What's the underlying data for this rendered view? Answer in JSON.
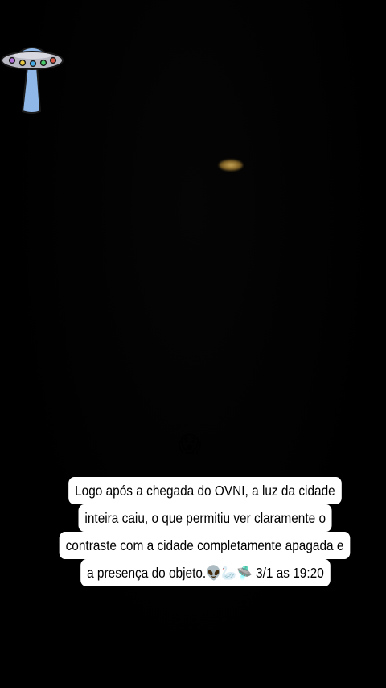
{
  "stickers": {
    "ufo": "ufo-sticker-icon",
    "scream": "😱"
  },
  "caption": {
    "lines": [
      "Logo após a chegada do OVNI, a luz da cidade",
      "inteira caiu, o que permitiu ver claramente o",
      "contraste com a cidade completamente apagada e",
      "a presença do objeto.👽🦢🛸 3/1 as 19:20"
    ]
  },
  "colors": {
    "background": "#000000",
    "caption_bg": "#ffffff",
    "caption_text": "#000000",
    "light": "#c9a85a",
    "ufo_body": "#8fb8e8"
  }
}
